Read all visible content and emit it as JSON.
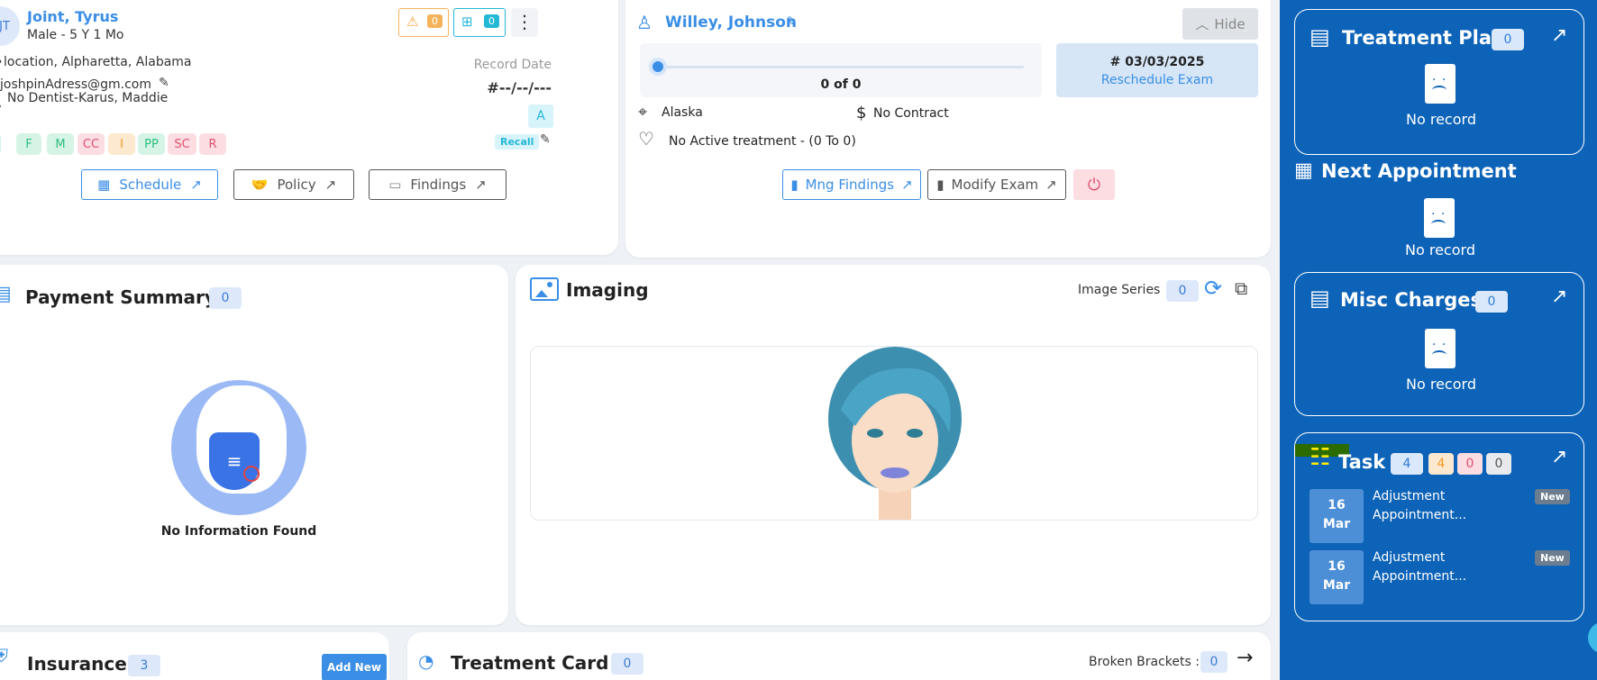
{
  "patient": {
    "initials": "JT",
    "name": "Joint, Tyrus",
    "demographics": "Male - 5 Y 1 Mo",
    "location": "location, Alpharetta, Alabama",
    "email": "joshpinAdress@gm.com",
    "dentist": "No Dentist-Karus, Maddie",
    "alert_count": "0",
    "family_count": "0",
    "record_date_label": "Record Date",
    "record_date_value": "#--/--/---",
    "status_letter": "A",
    "recall_label": "Recall",
    "tags": [
      "C",
      "F",
      "M",
      "CC",
      "I",
      "PP",
      "SC",
      "R"
    ],
    "buttons": {
      "schedule": "Schedule",
      "policy": "Policy",
      "findings": "Findings"
    }
  },
  "doctor": {
    "name": "Willey, Johnson",
    "hide_label": "Hide",
    "progress_text": "0 of 0",
    "progress_fraction": 0,
    "exam_date": "# 03/03/2025",
    "reschedule_label": "Reschedule Exam",
    "state": "Alaska",
    "contract": "No Contract",
    "treatment": "No Active treatment - (0 To 0)",
    "buttons": {
      "mng_findings": "Mng Findings",
      "modify_exam": "Modify Exam"
    }
  },
  "payment": {
    "title": "Payment Summary",
    "count": "0",
    "empty_text": "No Information Found"
  },
  "imaging": {
    "title": "Imaging",
    "series_label": "Image Series",
    "series_count": "0"
  },
  "insurance": {
    "title": "Insurance",
    "count": "3",
    "add_label": "Add New"
  },
  "treatment_card": {
    "title": "Treatment Card",
    "count": "0",
    "broken_label": "Broken Brackets :",
    "broken_count": "0"
  },
  "right_panel": {
    "treatment_plan": {
      "title": "Treatment Plan",
      "count": "0",
      "empty": "No record"
    },
    "next_appointment": {
      "title": "Next Appointment",
      "empty": "No record"
    },
    "misc_charges": {
      "title": "Misc Charges",
      "count": "0",
      "empty": "No record"
    },
    "task": {
      "title": "Task",
      "counts": [
        "4",
        "4",
        "0",
        "0"
      ],
      "items": [
        {
          "day": "16",
          "month": "Mar",
          "text": "Adjustment Appointment...",
          "tag": "New"
        },
        {
          "day": "16",
          "month": "Mar",
          "text": "Adjustment Appointment...",
          "tag": "New"
        }
      ]
    }
  },
  "colors": {
    "brand_blue": "#0d63b8",
    "accent": "#3a8ee6"
  }
}
